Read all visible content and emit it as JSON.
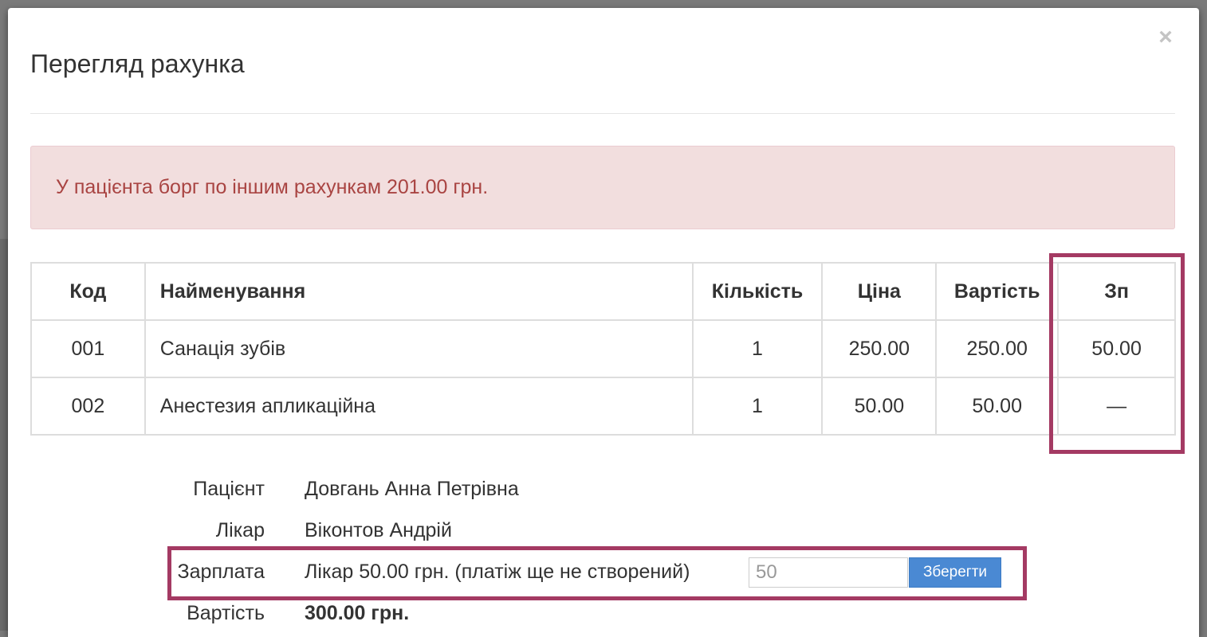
{
  "modal": {
    "title": "Перегляд рахунка",
    "close_glyph": "×"
  },
  "alert": {
    "text": "У пацієнта борг по іншим рахункам 201.00 грн."
  },
  "table": {
    "headers": [
      "Код",
      "Найменування",
      "Кількість",
      "Ціна",
      "Вартість",
      "Зп"
    ],
    "rows": [
      [
        "001",
        "Санація зубів",
        "1",
        "250.00",
        "250.00",
        "50.00"
      ],
      [
        "002",
        "Анестезия апликаційна",
        "1",
        "50.00",
        "50.00",
        "—"
      ]
    ]
  },
  "details": {
    "patient_label": "Пацієнт",
    "patient_value": "Довгань Анна Петрівна",
    "doctor_label": "Лікар",
    "doctor_value": "Віконтов Андрій",
    "salary_label": "Зарплата",
    "salary_value": "Лікар 50.00 грн. (платіж ще не створений)",
    "salary_input_value": "50",
    "save_label": "Зберегти",
    "cost_label": "Вартість",
    "cost_value": "300.00 грн."
  },
  "colors": {
    "highlight": "#a43a63",
    "alert_bg": "#f2dede",
    "alert_text": "#a94442",
    "button": "#4a89d3"
  }
}
